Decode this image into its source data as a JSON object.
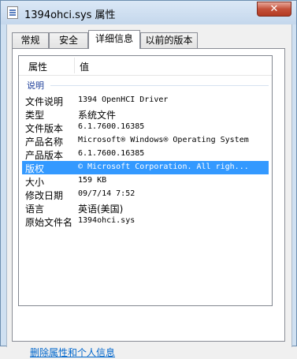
{
  "window": {
    "title": "1394ohci.sys 属性",
    "close_glyph": "✕"
  },
  "tabs": [
    {
      "label": "常规",
      "active": false
    },
    {
      "label": "安全",
      "active": false
    },
    {
      "label": "详细信息",
      "active": true
    },
    {
      "label": "以前的版本",
      "active": false
    }
  ],
  "details": {
    "columns": [
      "属性",
      "值"
    ],
    "group_label": "说明",
    "rows": [
      {
        "key": "文件说明",
        "value": "1394 OpenHCI Driver"
      },
      {
        "key": "类型",
        "value": "系统文件"
      },
      {
        "key": "文件版本",
        "value": "6.1.7600.16385"
      },
      {
        "key": "产品名称",
        "value": "Microsoft® Windows® Operating System"
      },
      {
        "key": "产品版本",
        "value": "6.1.7600.16385"
      },
      {
        "key": "版权",
        "value": "© Microsoft Corporation. All righ...",
        "selected": true
      },
      {
        "key": "大小",
        "value": "159 KB"
      },
      {
        "key": "修改日期",
        "value": "09/7/14 7:52"
      },
      {
        "key": "语言",
        "value": "英语(美国)"
      },
      {
        "key": "原始文件名",
        "value": "1394ohci.sys"
      }
    ]
  },
  "remove_link": "删除属性和个人信息",
  "colors": {
    "selection": "#3399ff",
    "link": "#0066cc",
    "group_label": "#1e3f9a"
  }
}
